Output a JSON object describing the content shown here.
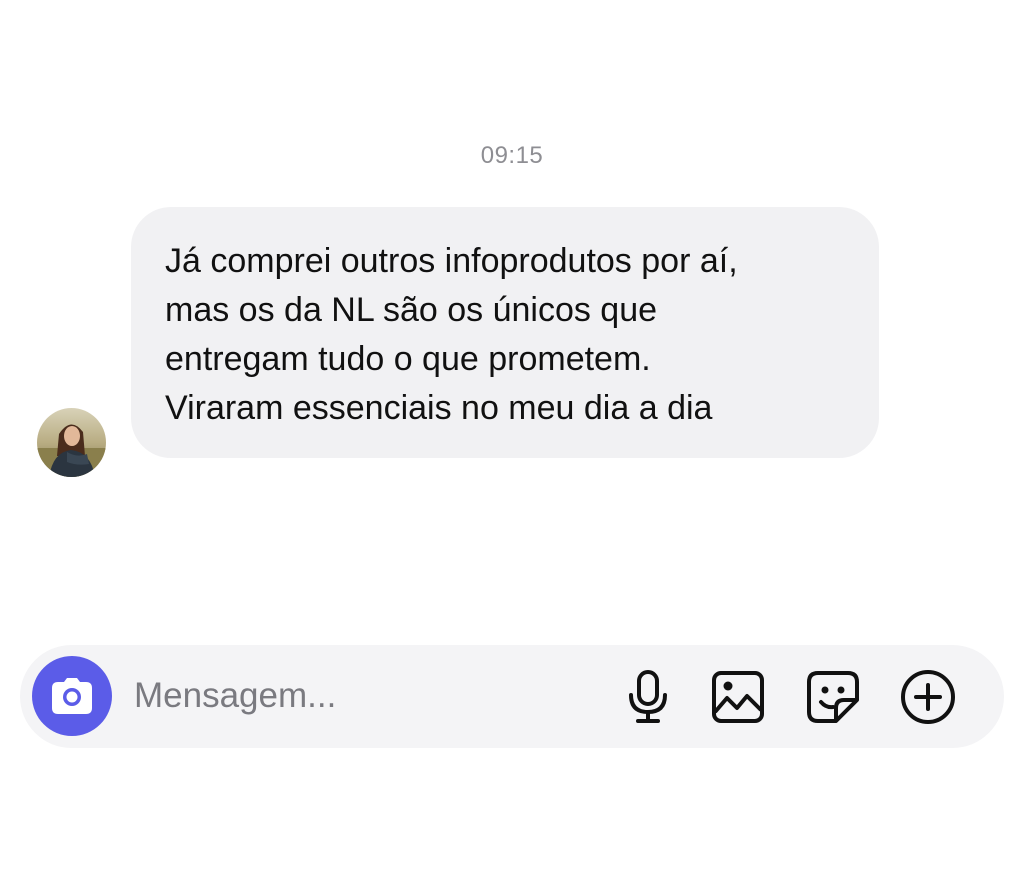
{
  "chat": {
    "timestamp": "09:15",
    "messages": [
      {
        "sender": "incoming",
        "text": "Já comprei outros infoprodutos por aí,\nmas os da NL são os únicos que\nentregam tudo o que prometem.\nViraram essenciais no meu dia a dia"
      }
    ]
  },
  "composer": {
    "placeholder": "Mensagem...",
    "value": "",
    "icons": [
      "camera-icon",
      "microphone-icon",
      "gallery-icon",
      "sticker-icon",
      "plus-icon"
    ]
  },
  "colors": {
    "accent": "#5b5ce8",
    "bubble_background": "#f1f1f3",
    "composer_background": "#f4f4f6",
    "timestamp_text": "#8e8e93",
    "icon_stroke": "#111111"
  }
}
